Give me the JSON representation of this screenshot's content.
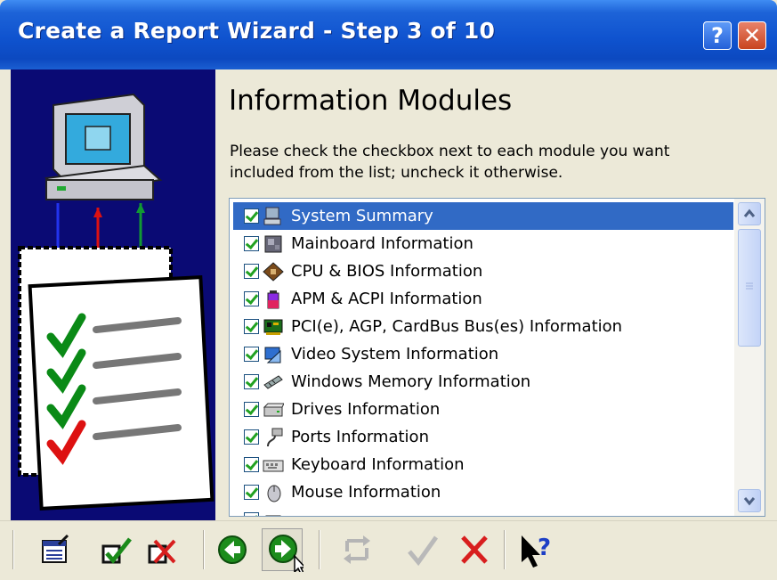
{
  "window": {
    "title": "Create a Report Wizard - Step 3 of 10",
    "help_label": "?",
    "close_label": "✕"
  },
  "page": {
    "heading": "Information Modules",
    "instructions": "Please check the checkbox next to each module you want included from the list; uncheck it otherwise."
  },
  "modules": [
    {
      "label": "System Summary",
      "checked": true,
      "selected": true
    },
    {
      "label": "Mainboard Information",
      "checked": true
    },
    {
      "label": "CPU & BIOS Information",
      "checked": true
    },
    {
      "label": "APM & ACPI Information",
      "checked": true
    },
    {
      "label": "PCI(e), AGP, CardBus Bus(es) Information",
      "checked": true
    },
    {
      "label": "Video System Information",
      "checked": true
    },
    {
      "label": "Windows Memory Information",
      "checked": true
    },
    {
      "label": "Drives Information",
      "checked": true
    },
    {
      "label": "Ports Information",
      "checked": true
    },
    {
      "label": "Keyboard Information",
      "checked": true
    },
    {
      "label": "Mouse Information",
      "checked": true
    }
  ],
  "toolbar": {
    "buttons": [
      "report-options-icon",
      "check-all-icon",
      "uncheck-all-icon",
      "back-icon",
      "next-icon",
      "swap-icon",
      "ok-icon",
      "cancel-icon",
      "help-pointer-icon"
    ]
  },
  "colors": {
    "titlebar": "#0c49c0",
    "selection": "#316ac5",
    "side_panel": "#0a0a74",
    "face": "#ece9d8"
  }
}
